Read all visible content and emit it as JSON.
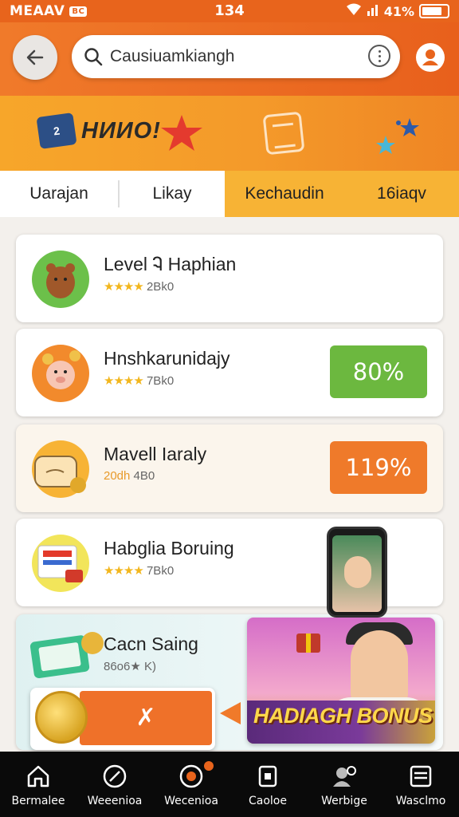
{
  "status_bar": {
    "carrier": "MEAAV",
    "badge": "BC",
    "time": "134",
    "battery": "41%"
  },
  "header": {
    "search_value": "Causiuamkiangh"
  },
  "banner": {
    "logo_box": "2",
    "logo_text": "HИИO!"
  },
  "tabs": [
    "Uarajan",
    "Likay",
    "Kechaudin",
    "16iaqv"
  ],
  "cards": [
    {
      "title": "Level Ꮈ Haphian",
      "rating": "★★★★",
      "meta": "2Bk0"
    },
    {
      "title": "Hnshkarunidajy",
      "rating": "★★★★",
      "meta": "7Bk0",
      "percent": "80%",
      "percent_color": "#6cb83f"
    },
    {
      "title": "Mavell Iaraly",
      "rating": "20dh",
      "meta": "4B0",
      "percent": "119%",
      "percent_color": "#ef7a2a"
    },
    {
      "title": "Habglia Boruing",
      "rating": "★★★★",
      "meta": "7Bk0"
    },
    {
      "title": "Cacn Saing",
      "rating": "",
      "meta": "86o6★ K)"
    }
  ],
  "promo": {
    "bonus_text": "HADIAGH BONUS",
    "action_label": "✗"
  },
  "bottom_nav": [
    {
      "label": "Bermalee",
      "icon": "home-icon"
    },
    {
      "label": "Weeenioa",
      "icon": "compass-icon"
    },
    {
      "label": "Wecenioa",
      "icon": "target-icon"
    },
    {
      "label": "Caoloe",
      "icon": "card-icon"
    },
    {
      "label": "Werbige",
      "icon": "user-search-icon"
    },
    {
      "label": "Wasclmo",
      "icon": "menu-icon"
    }
  ],
  "colors": {
    "primary": "#e8641c",
    "accent": "#f7b335",
    "green": "#6cb83f",
    "orange_btn": "#ef7a2a"
  }
}
